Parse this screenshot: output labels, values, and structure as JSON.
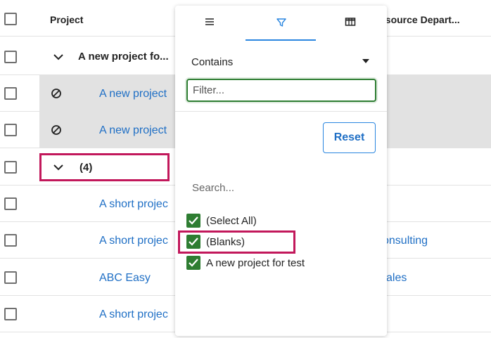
{
  "header": {
    "project_label": "Project",
    "resource_dept_label": "esource Depart..."
  },
  "groups": {
    "group1_label": "A new project fo...",
    "group2_label": "(4)"
  },
  "rows": {
    "r1": "A new project",
    "r2": "A new project",
    "r3": "A short projec",
    "r4": "A short projec",
    "r5": "ABC Easy",
    "r6": "A short projec"
  },
  "departments": {
    "r4": "onsulting",
    "r5": "ales"
  },
  "filter_popup": {
    "tabs": [
      {
        "name": "general-menu",
        "icon": "hamburger-icon"
      },
      {
        "name": "filter",
        "icon": "filter-icon"
      },
      {
        "name": "columns",
        "icon": "columns-icon"
      }
    ],
    "operator": "Contains",
    "filter_placeholder": "Filter...",
    "reset_label": "Reset",
    "search_placeholder": "Search...",
    "options": [
      "(Select All)",
      "(Blanks)",
      "A new project for test"
    ]
  },
  "colors": {
    "accent": "#1f6fc5",
    "highlight": "#c2185b",
    "checkbox_checked": "#2e7d32"
  }
}
